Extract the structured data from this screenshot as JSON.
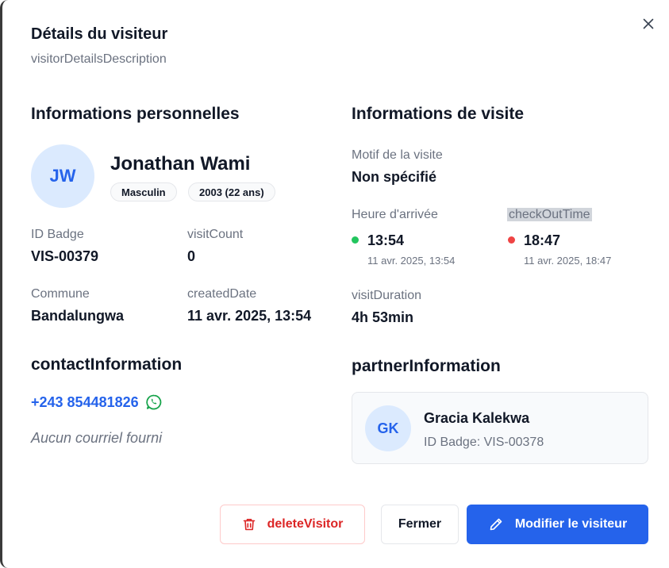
{
  "dialog": {
    "title": "Détails du visiteur",
    "description": "visitorDetailsDescription"
  },
  "personal": {
    "heading": "Informations personnelles",
    "initials": "JW",
    "name": "Jonathan Wami",
    "gender": "Masculin",
    "birth": "2003 (22 ans)",
    "badge_label": "ID Badge",
    "badge_value": "VIS-00379",
    "visit_count_label": "visitCount",
    "visit_count_value": "0",
    "commune_label": "Commune",
    "commune_value": "Bandalungwa",
    "created_label": "createdDate",
    "created_value": "11 avr. 2025, 13:54"
  },
  "contact": {
    "heading": "contactInformation",
    "phone": "+243 854481826",
    "email_empty": "Aucun courriel fourni"
  },
  "visit": {
    "heading": "Informations de visite",
    "reason_label": "Motif de la visite",
    "reason_value": "Non spécifié",
    "arrival_label": "Heure d'arrivée",
    "arrival_time": "13:54",
    "arrival_full": "11 avr. 2025, 13:54",
    "checkout_label": "checkOutTime",
    "checkout_time": "18:47",
    "checkout_full": "11 avr. 2025, 18:47",
    "duration_label": "visitDuration",
    "duration_value": "4h 53min"
  },
  "partner": {
    "heading": "partnerInformation",
    "initials": "GK",
    "name": "Gracia Kalekwa",
    "badge": "ID Badge: VIS-00378"
  },
  "actions": {
    "delete_label": "deleteVisitor",
    "close_label": "Fermer",
    "edit_label": "Modifier le visiteur"
  },
  "colors": {
    "accent": "#2563eb",
    "danger": "#dc2626",
    "arrival_dot": "#22c55e",
    "checkout_dot": "#ef4444",
    "whatsapp": "#16a34a"
  },
  "icons": {
    "close": "close-icon",
    "whatsapp": "whatsapp-icon",
    "delete": "trash-icon",
    "edit": "pencil-icon"
  }
}
